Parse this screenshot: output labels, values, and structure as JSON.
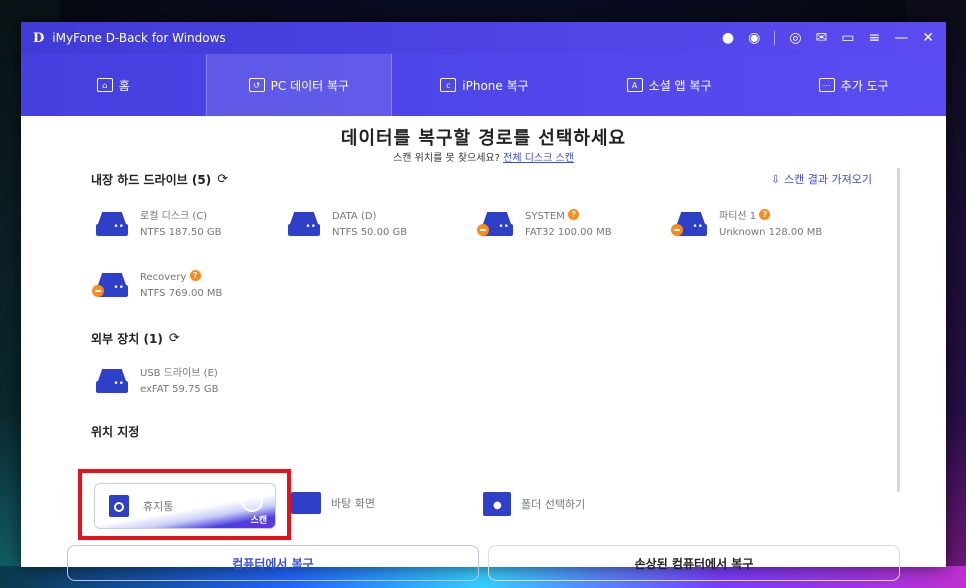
{
  "titlebar": {
    "logo": "D",
    "title": "iMyFone D-Back for Windows"
  },
  "nav": [
    {
      "label": "홈",
      "icon": "home-icon"
    },
    {
      "label": "PC 데이터 복구",
      "icon": "pc-recovery-icon"
    },
    {
      "label": "iPhone 복구",
      "icon": "iphone-icon"
    },
    {
      "label": "소셜 앱 복구",
      "icon": "social-app-icon"
    },
    {
      "label": "추가 도구",
      "icon": "more-tools-icon"
    }
  ],
  "main": {
    "heading": "데이터를 복구할 경로를 선택하세요",
    "sub_prefix": "스캔 위치를 못 찾으세요? ",
    "sub_link": "전체 디스크 스캔",
    "import_link": "스캔 결과 가져오기"
  },
  "internal": {
    "title": "내장 하드 드라이브 (5)",
    "drives": [
      {
        "name": "로컬 디스크 (C)",
        "info": "NTFS  187.50 GB",
        "warn": false,
        "help": false
      },
      {
        "name": "DATA (D)",
        "info": "NTFS  50.00 GB",
        "warn": false,
        "help": false
      },
      {
        "name": "SYSTEM",
        "info": "FAT32  100.00 MB",
        "warn": true,
        "help": true
      },
      {
        "name": "파티션 1",
        "info": "Unknown  128.00 MB",
        "warn": true,
        "help": true
      },
      {
        "name": "Recovery",
        "info": "NTFS  769.00 MB",
        "warn": true,
        "help": true
      }
    ]
  },
  "external": {
    "title": "외부 장치 (1)",
    "drives": [
      {
        "name": "USB 드라이브 (E)",
        "info": "exFAT  59.75 GB"
      }
    ]
  },
  "location": {
    "title": "위치 지정",
    "recycle_bin": "휴지통",
    "scan_label": "스캔",
    "desktop": "바탕 화면",
    "folder": "폴더 선택하기"
  },
  "buttons": {
    "recover_pc": "컴퓨터에서 복구",
    "recover_damaged": "손상된 컴퓨터에서 복구"
  },
  "colors": {
    "accent": "#4a44e4",
    "warning": "#ff8a1a",
    "highlight": "#e8101a"
  }
}
